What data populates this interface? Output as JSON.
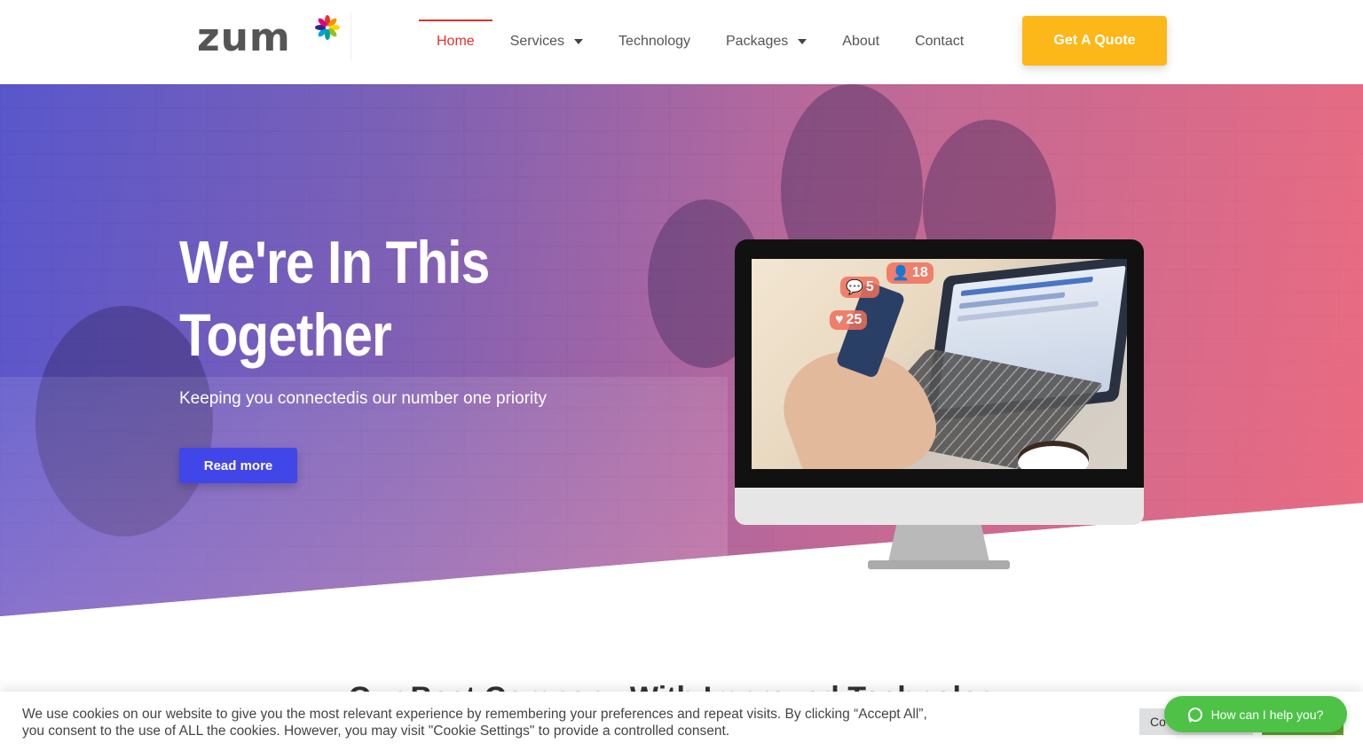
{
  "header": {
    "logo_text": "zum",
    "nav": [
      {
        "label": "Home",
        "active": true
      },
      {
        "label": "Services",
        "dropdown": true
      },
      {
        "label": "Technology"
      },
      {
        "label": "Packages",
        "dropdown": true
      },
      {
        "label": "About"
      },
      {
        "label": "Contact"
      }
    ],
    "cta_label": "Get A Quote",
    "colors": {
      "active": "#e0302c",
      "cta": "#fcb719"
    }
  },
  "hero": {
    "title_line1": "We're In This",
    "title_line2": "Together",
    "subtitle": "Keeping you connectedis our number one priority",
    "button_label": "Read more",
    "button_color": "#4046e8",
    "screen_badges": {
      "comments": "5",
      "likes": "25",
      "followers": "18"
    }
  },
  "next_section": {
    "heading_partial": "Our Best Company With Improved Technology"
  },
  "cookie_banner": {
    "text": "We use cookies on our website to give you the most relevant experience by remembering your preferences and repeat visits. By clicking “Accept All”, you consent to the use of ALL the cookies. However, you may visit \"Cookie Settings\" to provide a controlled consent.",
    "settings_label": "Co",
    "accept_color": "#61a229"
  },
  "whatsapp": {
    "label": "How can I help you?",
    "icon": "whatsapp-icon",
    "color": "#4dc247"
  }
}
